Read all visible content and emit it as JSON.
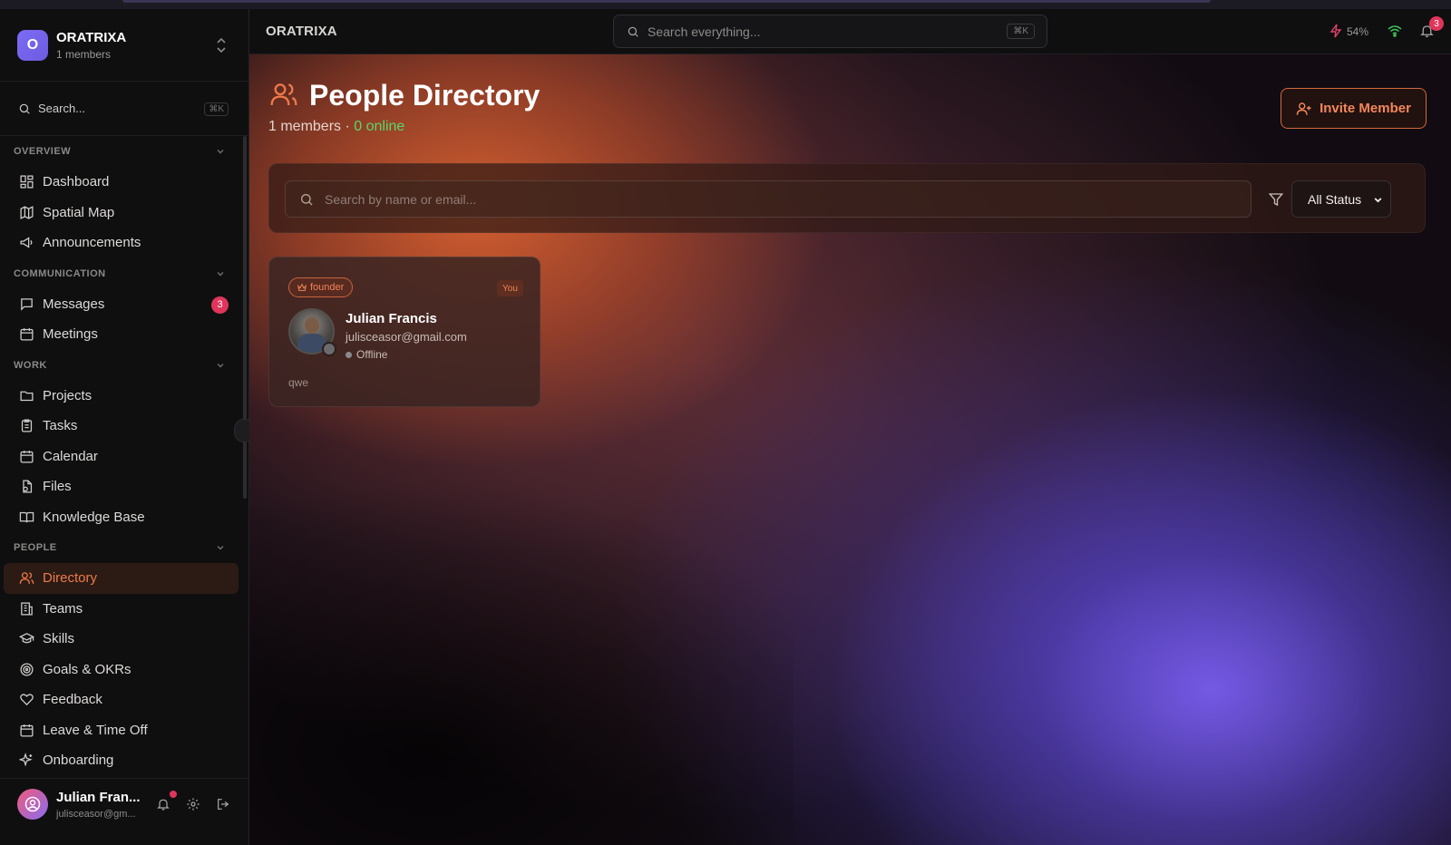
{
  "workspace": {
    "name": "ORATRIXA",
    "members": "1 members",
    "initial": "O"
  },
  "sidebar": {
    "search_placeholder": "Search...",
    "search_shortcut": "⌘K",
    "sections": [
      {
        "title": "OVERVIEW",
        "items": [
          {
            "label": "Dashboard",
            "icon": "dashboard-icon"
          },
          {
            "label": "Spatial Map",
            "icon": "map-icon"
          },
          {
            "label": "Announcements",
            "icon": "megaphone-icon"
          }
        ]
      },
      {
        "title": "COMMUNICATION",
        "items": [
          {
            "label": "Messages",
            "icon": "message-icon",
            "badge": "3"
          },
          {
            "label": "Meetings",
            "icon": "calendar-icon"
          }
        ]
      },
      {
        "title": "WORK",
        "items": [
          {
            "label": "Projects",
            "icon": "folder-icon"
          },
          {
            "label": "Tasks",
            "icon": "clipboard-icon"
          },
          {
            "label": "Calendar",
            "icon": "calendar-icon"
          },
          {
            "label": "Files",
            "icon": "files-icon"
          },
          {
            "label": "Knowledge Base",
            "icon": "book-icon"
          }
        ]
      },
      {
        "title": "PEOPLE",
        "items": [
          {
            "label": "Directory",
            "icon": "users-icon",
            "active": true
          },
          {
            "label": "Teams",
            "icon": "building-icon"
          },
          {
            "label": "Skills",
            "icon": "graduation-cap-icon"
          },
          {
            "label": "Goals & OKRs",
            "icon": "target-icon"
          },
          {
            "label": "Feedback",
            "icon": "heart-icon"
          },
          {
            "label": "Leave & Time Off",
            "icon": "calendar-icon"
          },
          {
            "label": "Onboarding",
            "icon": "sparkles-icon"
          }
        ]
      }
    ]
  },
  "user": {
    "name": "Julian Fran...",
    "email": "julisceasor@gm..."
  },
  "header": {
    "title": "ORATRIXA",
    "search_placeholder": "Search everything...",
    "search_shortcut": "⌘K",
    "battery": "54%",
    "notifications": "3"
  },
  "page": {
    "title": "People Directory",
    "members_text": "1 members",
    "separator": " · ",
    "online_text": "0 online",
    "invite_label": "Invite Member",
    "search_placeholder": "Search by name or email...",
    "status_filter": "All Status"
  },
  "members": [
    {
      "role": "founder",
      "you_label": "You",
      "name": "Julian Francis",
      "email": "julisceasor@gmail.com",
      "status": "Offline",
      "bio": "qwe"
    }
  ],
  "colors": {
    "accent": "#f07a4a",
    "online": "#59d66a",
    "badge": "#e0355a",
    "brand": "#7c6cf5"
  }
}
